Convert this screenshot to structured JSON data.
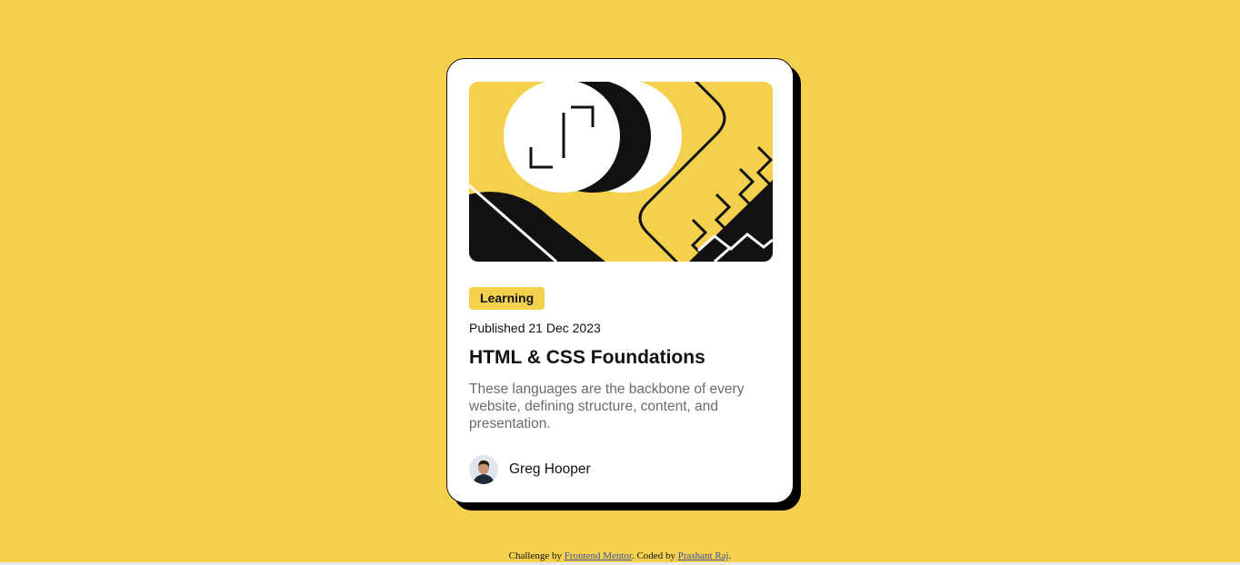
{
  "page": {
    "background_color": "#f4d04e"
  },
  "card": {
    "hero": {
      "icon": "illustration-article"
    },
    "tag": {
      "label": "Learning",
      "color": "#f4d04e"
    },
    "published": "Published 21 Dec 2023",
    "title": "HTML & CSS Foundations",
    "description": "These languages are the backbone of every website, defining structure, content, and presentation.",
    "author": {
      "name": "Greg Hooper",
      "avatar_icon": "avatar-greg-hooper"
    }
  },
  "footer": {
    "prefix": "Challenge by",
    "link1": "Frontend Mentor",
    "middle": ". Coded by",
    "link2": "Prashant Raj",
    "suffix": ".",
    "link_color": "#3e52a3"
  }
}
